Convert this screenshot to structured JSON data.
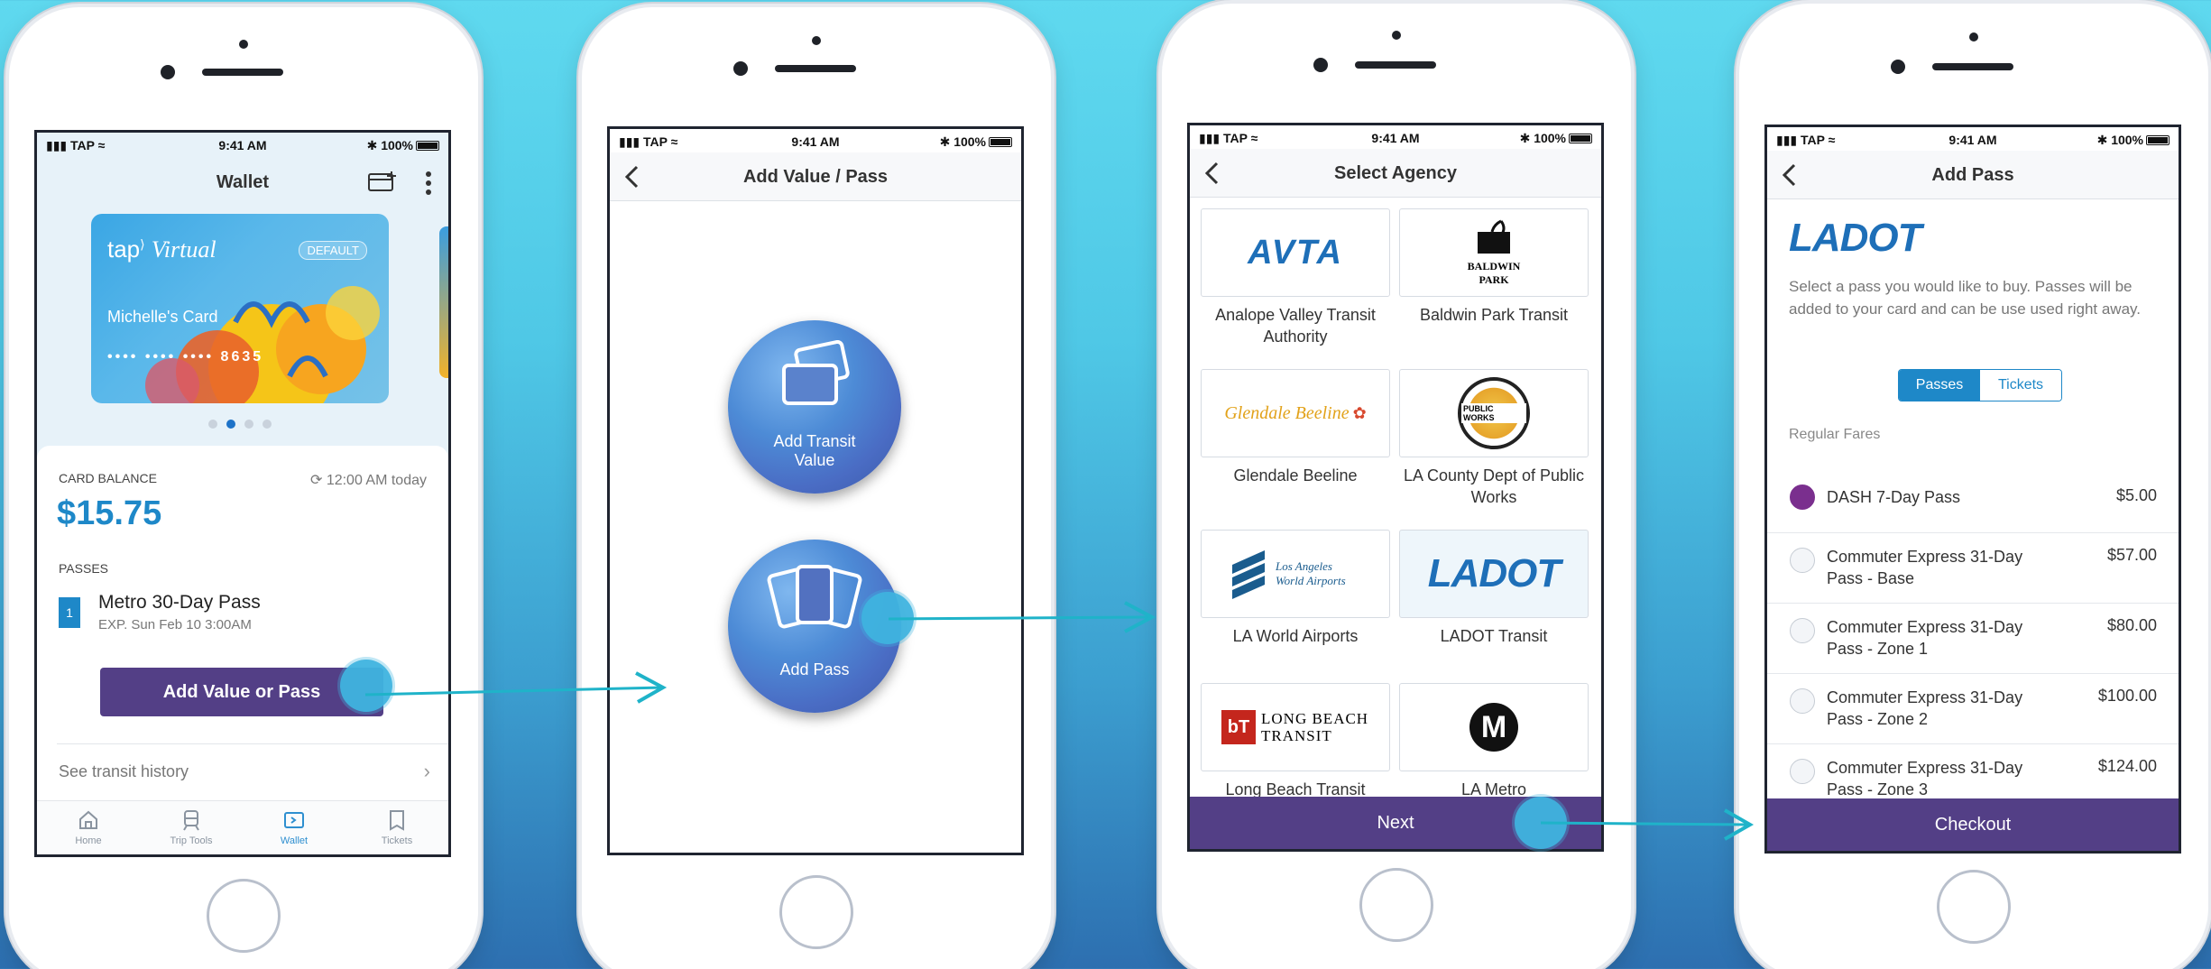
{
  "colors": {
    "accent_blue": "#1e88c8",
    "purple": "#533f86",
    "selected_radio": "#7a2f8e",
    "bg_cyan": "#5fd9ef"
  },
  "status": {
    "carrier": "TAP",
    "time": "9:41 AM",
    "battery": "100%"
  },
  "wallet": {
    "title": "Wallet",
    "card": {
      "brand": "tap",
      "brand_sup": "Virtual",
      "badge": "DEFAULT",
      "name": "Michelle's Card",
      "number": "••••  ••••  ••••  8635"
    },
    "balance_label": "CARD BALANCE",
    "balance_time": "12:00 AM today",
    "balance": "$15.75",
    "passes_label": "PASSES",
    "pass": {
      "badge": "1",
      "name": "Metro 30-Day Pass",
      "exp": "EXP. Sun Feb 10 3:00AM"
    },
    "add_button": "Add Value or Pass",
    "history_link": "See transit history",
    "tabs": [
      {
        "label": "Home",
        "icon": "home-icon"
      },
      {
        "label": "Trip Tools",
        "icon": "train-icon"
      },
      {
        "label": "Wallet",
        "icon": "wallet-icon"
      },
      {
        "label": "Tickets",
        "icon": "ticket-icon"
      }
    ]
  },
  "add_value": {
    "title": "Add Value / Pass",
    "option1": "Add Transit Value",
    "option2": "Add Pass"
  },
  "agency": {
    "title": "Select Agency",
    "items": [
      {
        "label": "Analope Valley Transit Authority",
        "logo": "AVTA"
      },
      {
        "label": "Baldwin Park Transit",
        "logo": "BALDWIN PARK"
      },
      {
        "label": "Glendale Beeline",
        "logo": "Glendale Beeline"
      },
      {
        "label": "LA County Dept of Public Works",
        "logo": "PUBLIC WORKS"
      },
      {
        "label": "LA World Airports",
        "logo": "Los Angeles World Airports"
      },
      {
        "label": "LADOT Transit",
        "logo": "LADOT"
      },
      {
        "label": "Long Beach Transit",
        "logo": "LONG BEACH TRANSIT"
      },
      {
        "label": "LA Metro",
        "logo": "M"
      }
    ],
    "next": "Next"
  },
  "add_pass": {
    "title": "Add Pass",
    "brand": "LADOT",
    "description": "Select a pass you would like to buy. Passes will be added to your card and can be use used right away.",
    "toggle": [
      "Passes",
      "Tickets"
    ],
    "section": "Regular Fares",
    "rows": [
      {
        "name": "DASH 7-Day Pass",
        "price": "$5.00"
      },
      {
        "name": "Commuter Express 31-Day Pass - Base",
        "price": "$57.00"
      },
      {
        "name": "Commuter Express 31-Day Pass - Zone 1",
        "price": "$80.00"
      },
      {
        "name": "Commuter Express 31-Day Pass - Zone 2",
        "price": "$100.00"
      },
      {
        "name": "Commuter Express 31-Day Pass - Zone 3",
        "price": "$124.00"
      }
    ],
    "checkout": "Checkout"
  }
}
